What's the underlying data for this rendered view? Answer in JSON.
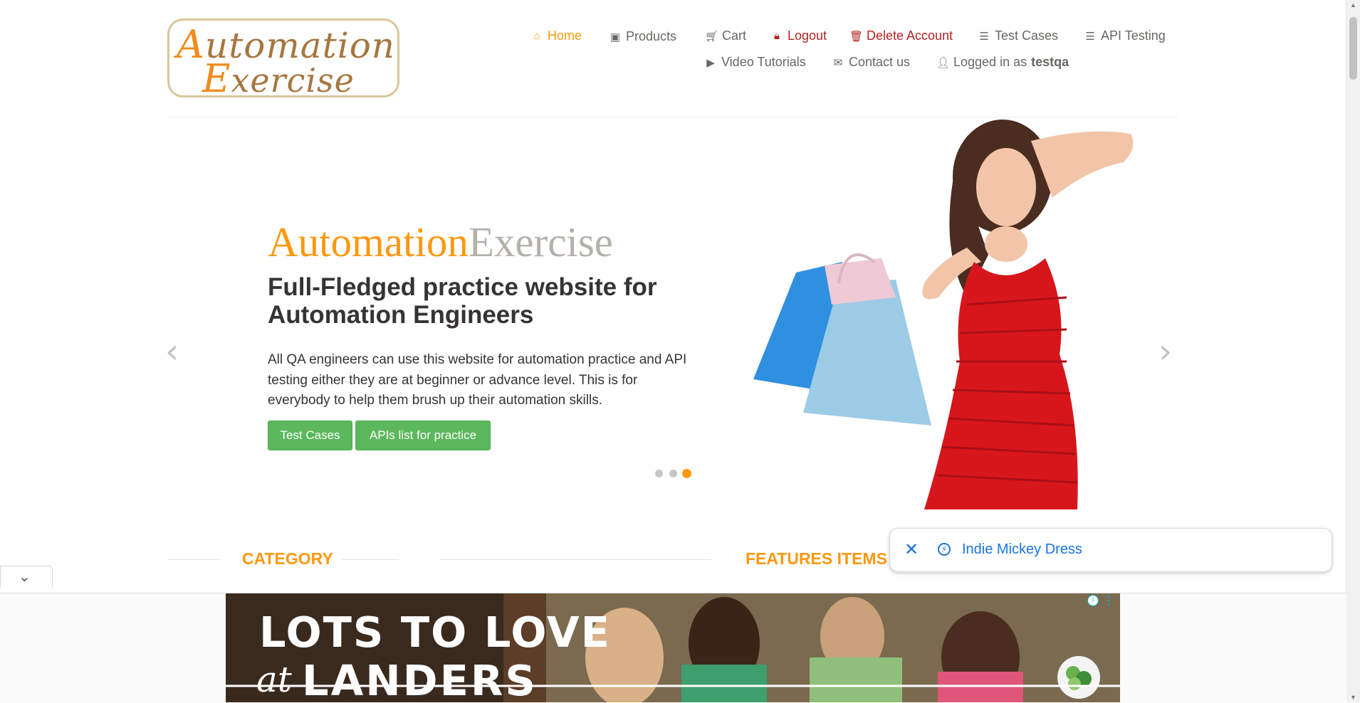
{
  "logo": {
    "line1_cap": "A",
    "line1_rest": "utomation",
    "line2_cap": "E",
    "line2_rest": "xercise"
  },
  "nav": {
    "row1": [
      {
        "label": "Home",
        "icon": "home-icon"
      },
      {
        "label": "Products",
        "icon": "briefcase-icon"
      },
      {
        "label": "Cart",
        "icon": "cart-icon"
      },
      {
        "label": "Logout",
        "icon": "lock-icon"
      },
      {
        "label": "Delete Account",
        "icon": "trash-icon"
      },
      {
        "label": "Test Cases",
        "icon": "list-icon"
      },
      {
        "label": "API Testing",
        "icon": "list-icon"
      }
    ],
    "row2": [
      {
        "label": "Video Tutorials",
        "icon": "youtube-icon"
      },
      {
        "label": "Contact us",
        "icon": "envelope-icon"
      },
      {
        "label": "Logged in as",
        "icon": "user-icon",
        "username": "testqa"
      }
    ]
  },
  "slider": {
    "brand_orange": "Automation",
    "brand_gray": "Exercise",
    "headline": "Full-Fledged practice website for Automation Engineers",
    "description": "All QA engineers can use this website for automation practice and API testing either they are at beginner or advance level. This is for everybody to help them brush up their automation skills.",
    "buttons": [
      "Test Cases",
      "APIs list for practice"
    ],
    "active_slide": 3,
    "slide_count": 3
  },
  "sections": {
    "category": "CATEGORY",
    "features": "FEATURES ITEMS"
  },
  "popup": {
    "text": "Indie Mickey Dress"
  },
  "ad": {
    "line1": "LOTS TO LOVE",
    "at": "at",
    "line2": "LANDERS"
  },
  "colors": {
    "accent": "#fe980f",
    "button": "#5cb85c",
    "danger": "#b22222",
    "link_blue": "#1a73e8"
  }
}
